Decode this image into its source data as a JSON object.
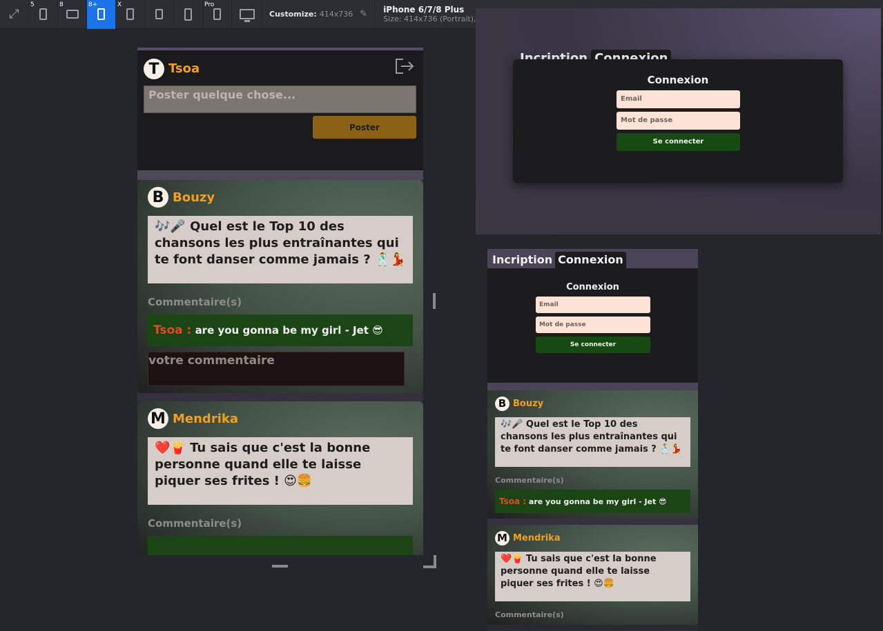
{
  "toolbar": {
    "devices": [
      {
        "badge": "5",
        "icon": "phone-icon"
      },
      {
        "badge": "8",
        "icon": "tablet-icon"
      },
      {
        "badge": "8+",
        "icon": "phone-icon"
      },
      {
        "badge": "X",
        "icon": "phone-icon"
      },
      {
        "badge": "",
        "icon": "phone-icon"
      },
      {
        "badge": "",
        "icon": "phone-icon"
      },
      {
        "badge": "Pro",
        "icon": "phone-icon"
      }
    ],
    "customize_label": "Customize:",
    "customize_value": "414x736",
    "device_name": "iPhone 6/7/8 Plus",
    "device_size": "Size: 414x736 (Portrait),"
  },
  "colors": {
    "accent_active": "#1a73e8",
    "username": "#f0a020",
    "comment_bg": "#1c4515",
    "comment_user": "#e04a2a",
    "post_button": "#8b6115"
  },
  "main": {
    "user": {
      "initial": "T",
      "name": "Tsoa"
    },
    "post_placeholder": "Poster quelque chose...",
    "post_button": "Poster",
    "posts": [
      {
        "initial": "B",
        "author": "Bouzy",
        "content": "🎶🎤 Quel est le Top 10 des chansons les plus entraînantes qui te font danser comme jamais ? 🕺💃",
        "comments_title": "Commentaire(s)",
        "comment_user": "Tsoa :",
        "comment_text": "are you gonna be my girl - Jet 😎",
        "comment_placeholder": "votre commentaire"
      },
      {
        "initial": "M",
        "author": "Mendrika",
        "content": "❤️🍟 Tu sais que c'est la bonne personne quand elle te laisse piquer ses frites ! 😍🍔",
        "comments_title": "Commentaire(s)"
      }
    ]
  },
  "preview_desktop": {
    "tabs": [
      "Incription",
      "Connexion"
    ],
    "form_title": "Connexion",
    "email_placeholder": "Email",
    "password_placeholder": "Mot de passe",
    "submit": "Se connecter"
  },
  "preview_mobile": {
    "tabs": [
      "Incription",
      "Connexion"
    ],
    "form_title": "Connexion",
    "email_placeholder": "Email",
    "password_placeholder": "Mot de passe",
    "submit": "Se connecter",
    "posts": [
      {
        "initial": "B",
        "author": "Bouzy",
        "content": "🎶🎤 Quel est le Top 10 des chansons les plus entraînantes qui te font danser comme jamais ? 🕺💃",
        "comments_title": "Commentaire(s)",
        "comment_user": "Tsoa :",
        "comment_text": "are you gonna be my girl - Jet 😎"
      },
      {
        "initial": "M",
        "author": "Mendrika",
        "content": "❤️🍟 Tu sais que c'est la bonne personne quand elle te laisse piquer ses frites ! 😍🍔",
        "comments_title": "Commentaire(s)"
      }
    ]
  }
}
